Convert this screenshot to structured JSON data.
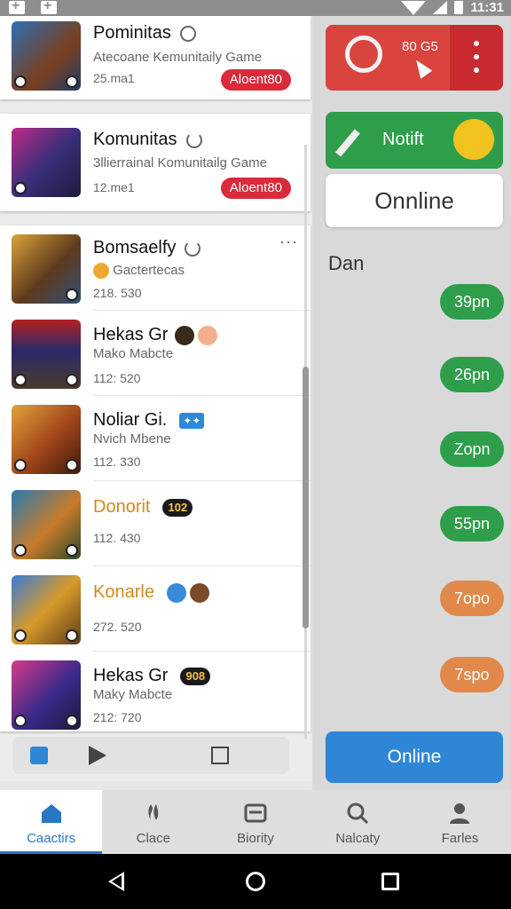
{
  "status_bar": {
    "time": "11:31"
  },
  "games": [
    {
      "title": "Pominitas",
      "subtitle": "Atecoane Kemunitaily Game",
      "meta": "25.ma1",
      "badge": "Aloent80"
    },
    {
      "title": "Komunitas",
      "subtitle": "3llierrainal Komunitailg Game",
      "meta": "12.me1",
      "badge": "Aloent80"
    },
    {
      "title": "Bomsaelfy",
      "subtitle": "Gactertecas",
      "meta": "218. 530"
    },
    {
      "title": "Hekas Gr",
      "subtitle": "Mako Mabcte",
      "meta": "112: 520"
    },
    {
      "title": "Noliar Gi.",
      "subtitle": "Nvich Mbene",
      "meta": "112. 330"
    },
    {
      "title": "Donorit",
      "subtitle": "",
      "meta": "112. 430",
      "tag": "102"
    },
    {
      "title": "Konarle",
      "subtitle": "",
      "meta": "272. 520"
    },
    {
      "title": "Hekas Gr",
      "subtitle": "Maky Mabcte",
      "meta": "212: 720",
      "tag": "908"
    }
  ],
  "right_panel": {
    "top_button_text": "80 G5",
    "notify_label": "Notift",
    "online_label": "Onnline",
    "section_label": "Dan",
    "times": [
      {
        "label": "39pn",
        "color": "#2f9e4a"
      },
      {
        "label": "26pn",
        "color": "#2f9e4a"
      },
      {
        "label": "Zopn",
        "color": "#2f9e4a"
      },
      {
        "label": "55pn",
        "color": "#2f9e4a"
      },
      {
        "label": "7opo",
        "color": "#e0894a"
      },
      {
        "label": "7spo",
        "color": "#e0894a"
      }
    ],
    "bottom_button_label": "Online"
  },
  "tabs": [
    {
      "label": "Caactirs",
      "icon": "home-icon",
      "active": true
    },
    {
      "label": "Clace",
      "icon": "flame-icon",
      "active": false
    },
    {
      "label": "Biority",
      "icon": "inbox-icon",
      "active": false
    },
    {
      "label": "Nalcaty",
      "icon": "search-icon",
      "active": false
    },
    {
      "label": "Farles",
      "icon": "person-icon",
      "active": false
    }
  ],
  "colors": {
    "accent": "#2877c4",
    "red": "#d92b3a",
    "green": "#2f9e4a",
    "orange": "#e0894a",
    "blue_button": "#2f86d6"
  }
}
